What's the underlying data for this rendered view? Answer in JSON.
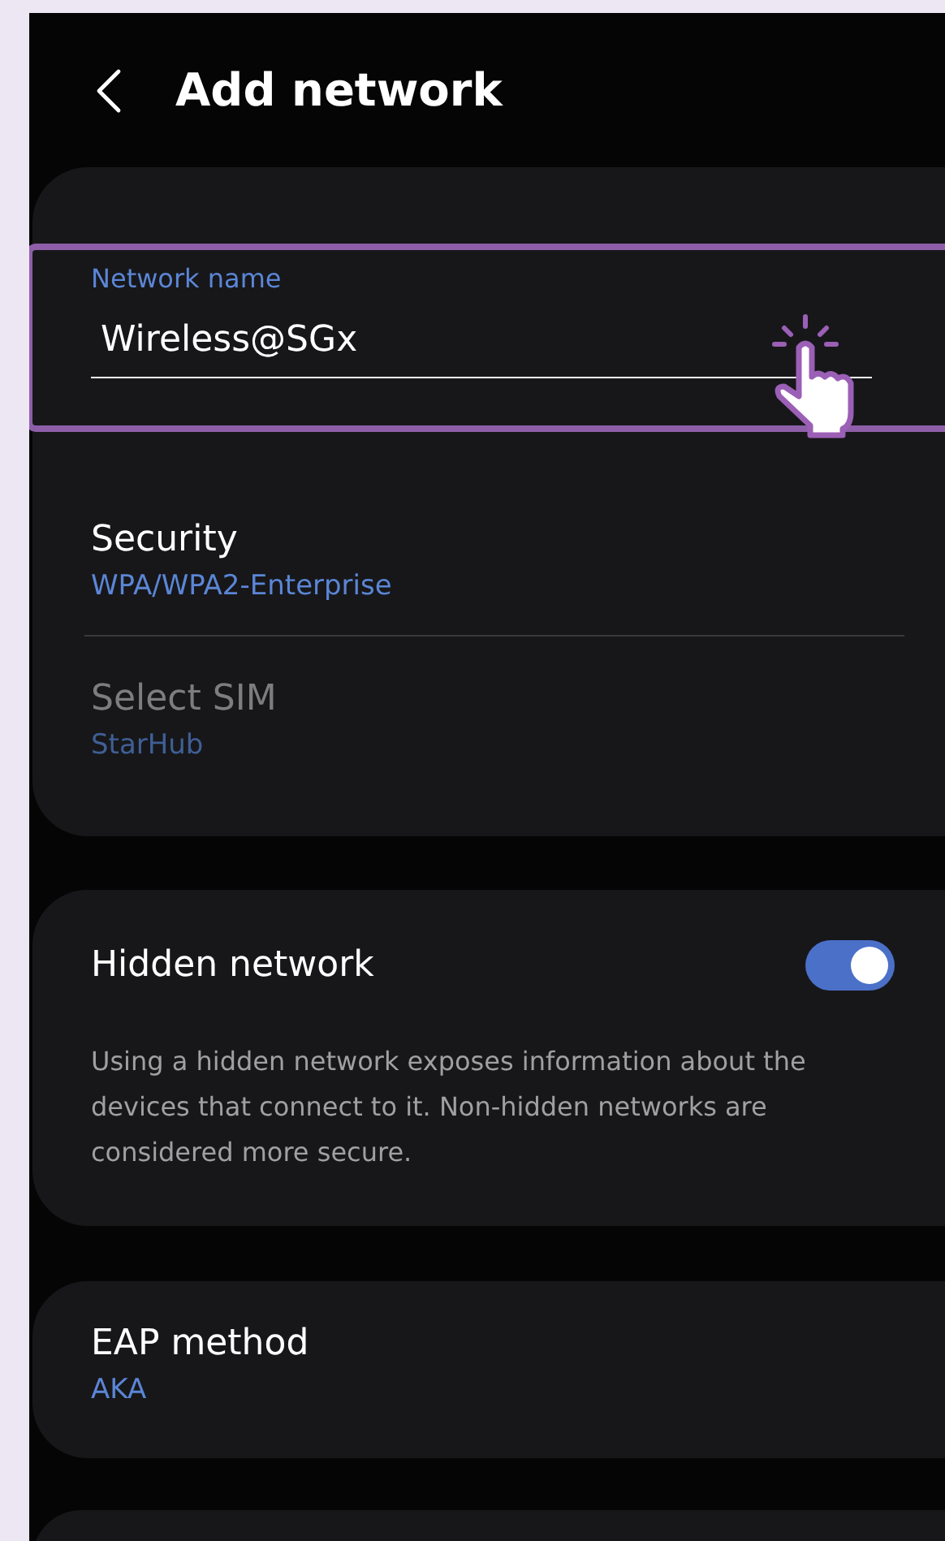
{
  "header": {
    "title": "Add network"
  },
  "network_name": {
    "label": "Network name",
    "value": "Wireless@SGx",
    "highlighted": true
  },
  "security": {
    "label": "Security",
    "value": "WPA/WPA2-Enterprise"
  },
  "select_sim": {
    "label": "Select SIM",
    "value": "StarHub",
    "disabled": true
  },
  "hidden_network": {
    "label": "Hidden network",
    "on": true,
    "description": "Using a hidden network exposes information about the devices that connect to it. Non-hidden networks are considered more secure."
  },
  "eap_method": {
    "label": "EAP method",
    "value": "AKA"
  }
}
